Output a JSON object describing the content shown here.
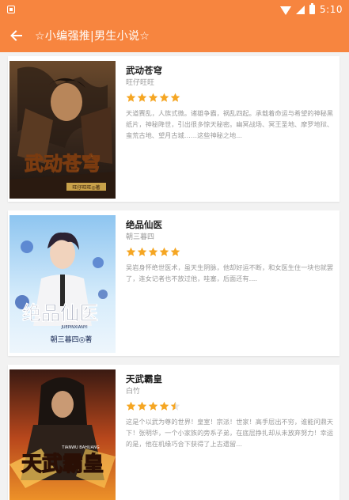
{
  "status_bar": {
    "time": "5:10"
  },
  "toolbar": {
    "title": "☆小编强推|男生小说☆"
  },
  "books": [
    {
      "title": "武动苍穹",
      "author": "旺仔旺旺",
      "rating": 5,
      "description": "天道赛乱，人族式微。诸雄争霸，祸乱四起。承载着命运与希望的神秘黑纸片，神秘降世，引出很多惊天秘密。幽冥战场、冥王圣地、摩罗地狱、蛮荒古地、望月古城……这些神秘之地...",
      "cover_text": "武动苍穹",
      "cover_sub": "旺仔旺旺◎著"
    },
    {
      "title": "绝品仙医",
      "author": "朝三暮四",
      "rating": 5,
      "description": "吴岩身怀绝世医术，虽天生阴脉，他却好运不断，和女医生住一块也就罢了，连女记者也不放过他，哇塞，后面还有....",
      "cover_text": "绝品仙医",
      "cover_pinyin": "JUEPINXIANYI",
      "cover_sub": "朝三暮四◎著"
    },
    {
      "title": "天武霸皇",
      "author": "白竹",
      "rating": 4.5,
      "description": "这是个以武为尊的世界！皇室！宗派！世家！高手层出不穷，谁能问鼎天下！张明华，一个小家族的旁系子弟，在底层挣扎却从未放弃努力！幸运的是，他在机缘巧合下获得了上古遗留...",
      "cover_text": "天武霸皇",
      "cover_pinyin": "TIANWU BAHUANG"
    }
  ],
  "colors": {
    "accent": "#f7853f",
    "star": "#f5a623"
  }
}
